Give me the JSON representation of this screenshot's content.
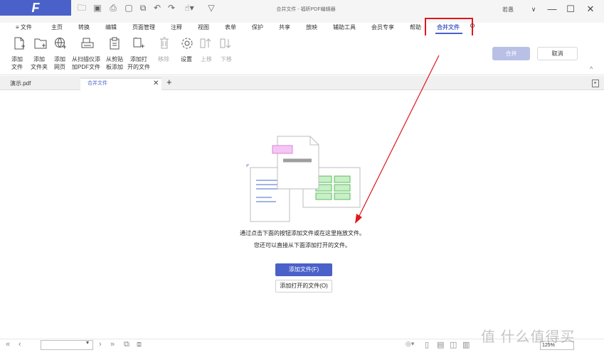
{
  "app": {
    "logo_text": "F",
    "window_title": "合并文件 - 福昕PDF编辑器",
    "user_name": "若愚",
    "window_controls": [
      "chevron-down",
      "minimize",
      "maximize",
      "close"
    ]
  },
  "menu": {
    "file": "≡ 文件",
    "items": [
      "主页",
      "转换",
      "编辑",
      "页面管理",
      "注释",
      "视图",
      "表单",
      "保护",
      "共享",
      "放映",
      "辅助工具",
      "会员专享",
      "帮助"
    ],
    "active": "合并文件"
  },
  "toolbar": {
    "add_file": [
      "添加",
      "文件"
    ],
    "add_folder": [
      "添加",
      "文件夹"
    ],
    "add_webpage": [
      "添加",
      "网页"
    ],
    "from_scanner": [
      "从扫描仪添",
      "加PDF文件"
    ],
    "from_clipboard": [
      "从剪贴",
      "板添加"
    ],
    "add_open_files": [
      "添加打",
      "开的文件"
    ],
    "remove": "移除",
    "settings": "设置",
    "move_up": "上移",
    "move_down": "下移",
    "action_button": "合并",
    "cancel_button": "取消"
  },
  "tabs": {
    "doc": "演示.pdf",
    "merge": "合并文件",
    "add": "+"
  },
  "content": {
    "line1": "通过点击下面的按钮添加文件或在这里拖放文件。",
    "line2": "您还可以直接从下面添加打开的文件。",
    "add_file_button": "添加文件(F)",
    "add_open_button": "添加打开的文件(O)"
  },
  "status": {
    "zoom": "125%",
    "watermark": "值 什么值得买"
  },
  "colors": {
    "accent": "#4a61c9",
    "highlight": "#e0161b",
    "illustration_pink": "#f5c6f5",
    "illustration_green": "#c8efc8"
  }
}
